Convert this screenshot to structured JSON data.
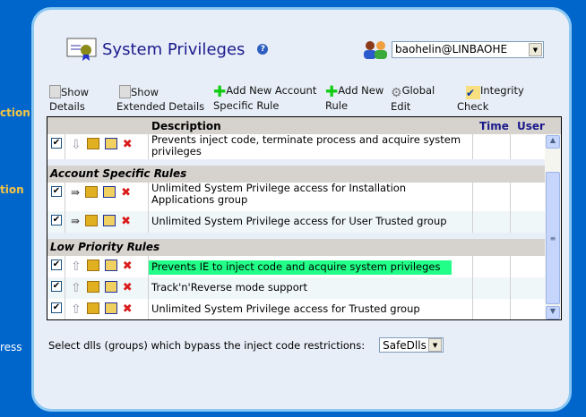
{
  "sidebar": {
    "items": [
      "ction",
      "tion",
      "ress"
    ]
  },
  "header": {
    "title": "System Privileges",
    "help": "?",
    "user": "baohelin@LINBAOHE"
  },
  "toolbar": {
    "show_details": [
      "Show",
      "Details"
    ],
    "show_extended": [
      "Show",
      "Extended Details"
    ],
    "add_account_rule": [
      "Add New Account",
      "Specific Rule"
    ],
    "add_rule": [
      "Add New",
      "Rule"
    ],
    "global_edit": [
      "Global",
      "Edit"
    ],
    "integrity_check": [
      "Integrity",
      "Check"
    ]
  },
  "table": {
    "columns": {
      "description": "Description",
      "time": "Time",
      "user": "User"
    },
    "rows0": [
      {
        "description": "Prevents inject code, terminate process and acquire system privileges",
        "checked": "✔"
      }
    ],
    "groups": [
      {
        "name": "Account Specific Rules",
        "rows": [
          {
            "description": "Unlimited System Privilege access for Installation Applications group",
            "checked": "✔"
          },
          {
            "description": "Unlimited System Privilege access for User Trusted group",
            "checked": "✔"
          }
        ]
      },
      {
        "name": "Low Priority Rules",
        "rows": [
          {
            "description": "Prevents IE to inject code and acquire system privileges",
            "checked": "✔",
            "highlighted": true
          },
          {
            "description": "Track'n'Reverse mode support",
            "checked": "✔"
          },
          {
            "description": "Unlimited System Privilege access for Trusted group",
            "checked": "✔"
          }
        ]
      }
    ]
  },
  "footer": {
    "label": "Select dlls (groups) which bypass the inject code restrictions:",
    "value": "SafeDlls"
  },
  "colors": {
    "background": "#0066cc",
    "highlight": "#22ff88",
    "title": "#1a1a8c"
  }
}
